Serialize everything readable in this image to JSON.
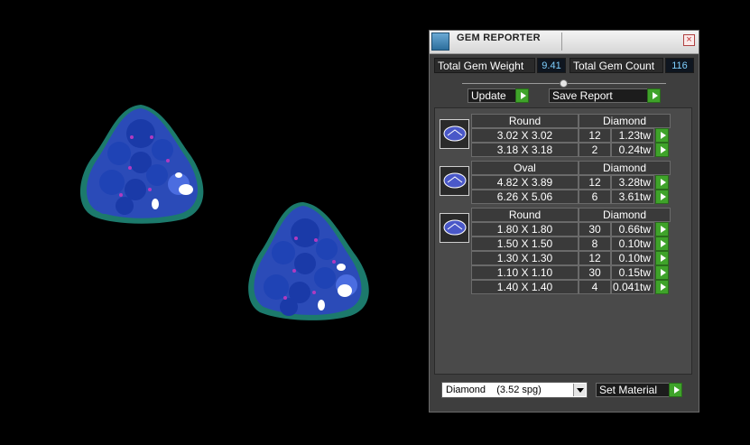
{
  "window": {
    "title": "GEM REPORTER"
  },
  "stats": {
    "total_weight_label": "Total Gem Weight",
    "total_weight_value": "9.41",
    "total_count_label": "Total Gem Count",
    "total_count_value": "116"
  },
  "buttons": {
    "update": "Update",
    "save_report": "Save Report",
    "set_material": "Set Material"
  },
  "groups": [
    {
      "shape": "Round",
      "material": "Diamond",
      "rows": [
        {
          "size": "3.02 X 3.02",
          "count": "12",
          "weight": "1.23tw"
        },
        {
          "size": "3.18 X 3.18",
          "count": "2",
          "weight": "0.24tw"
        }
      ]
    },
    {
      "shape": "Oval",
      "material": "Diamond",
      "rows": [
        {
          "size": "4.82 X 3.89",
          "count": "12",
          "weight": "3.28tw"
        },
        {
          "size": "6.26 X 5.06",
          "count": "6",
          "weight": "3.61tw"
        }
      ]
    },
    {
      "shape": "Round",
      "material": "Diamond",
      "rows": [
        {
          "size": "1.80 X 1.80",
          "count": "30",
          "weight": "0.66tw"
        },
        {
          "size": "1.50 X 1.50",
          "count": "8",
          "weight": "0.10tw"
        },
        {
          "size": "1.30 X 1.30",
          "count": "12",
          "weight": "0.10tw"
        },
        {
          "size": "1.10 X 1.10",
          "count": "30",
          "weight": "0.15tw"
        },
        {
          "size": "1.40 X 1.40",
          "count": "4",
          "weight": "0.041tw"
        }
      ]
    }
  ],
  "material_select": {
    "value": "Diamond    (3.52 spg)"
  },
  "colors": {
    "accent_green": "#3fa32a",
    "value_blue": "#7fd0ff",
    "gem_blue": "#1f3fb0"
  },
  "icons": [
    "app-icon",
    "close-icon",
    "play-icon",
    "round-gem-icon",
    "oval-gem-icon",
    "dropdown-arrow-icon"
  ]
}
